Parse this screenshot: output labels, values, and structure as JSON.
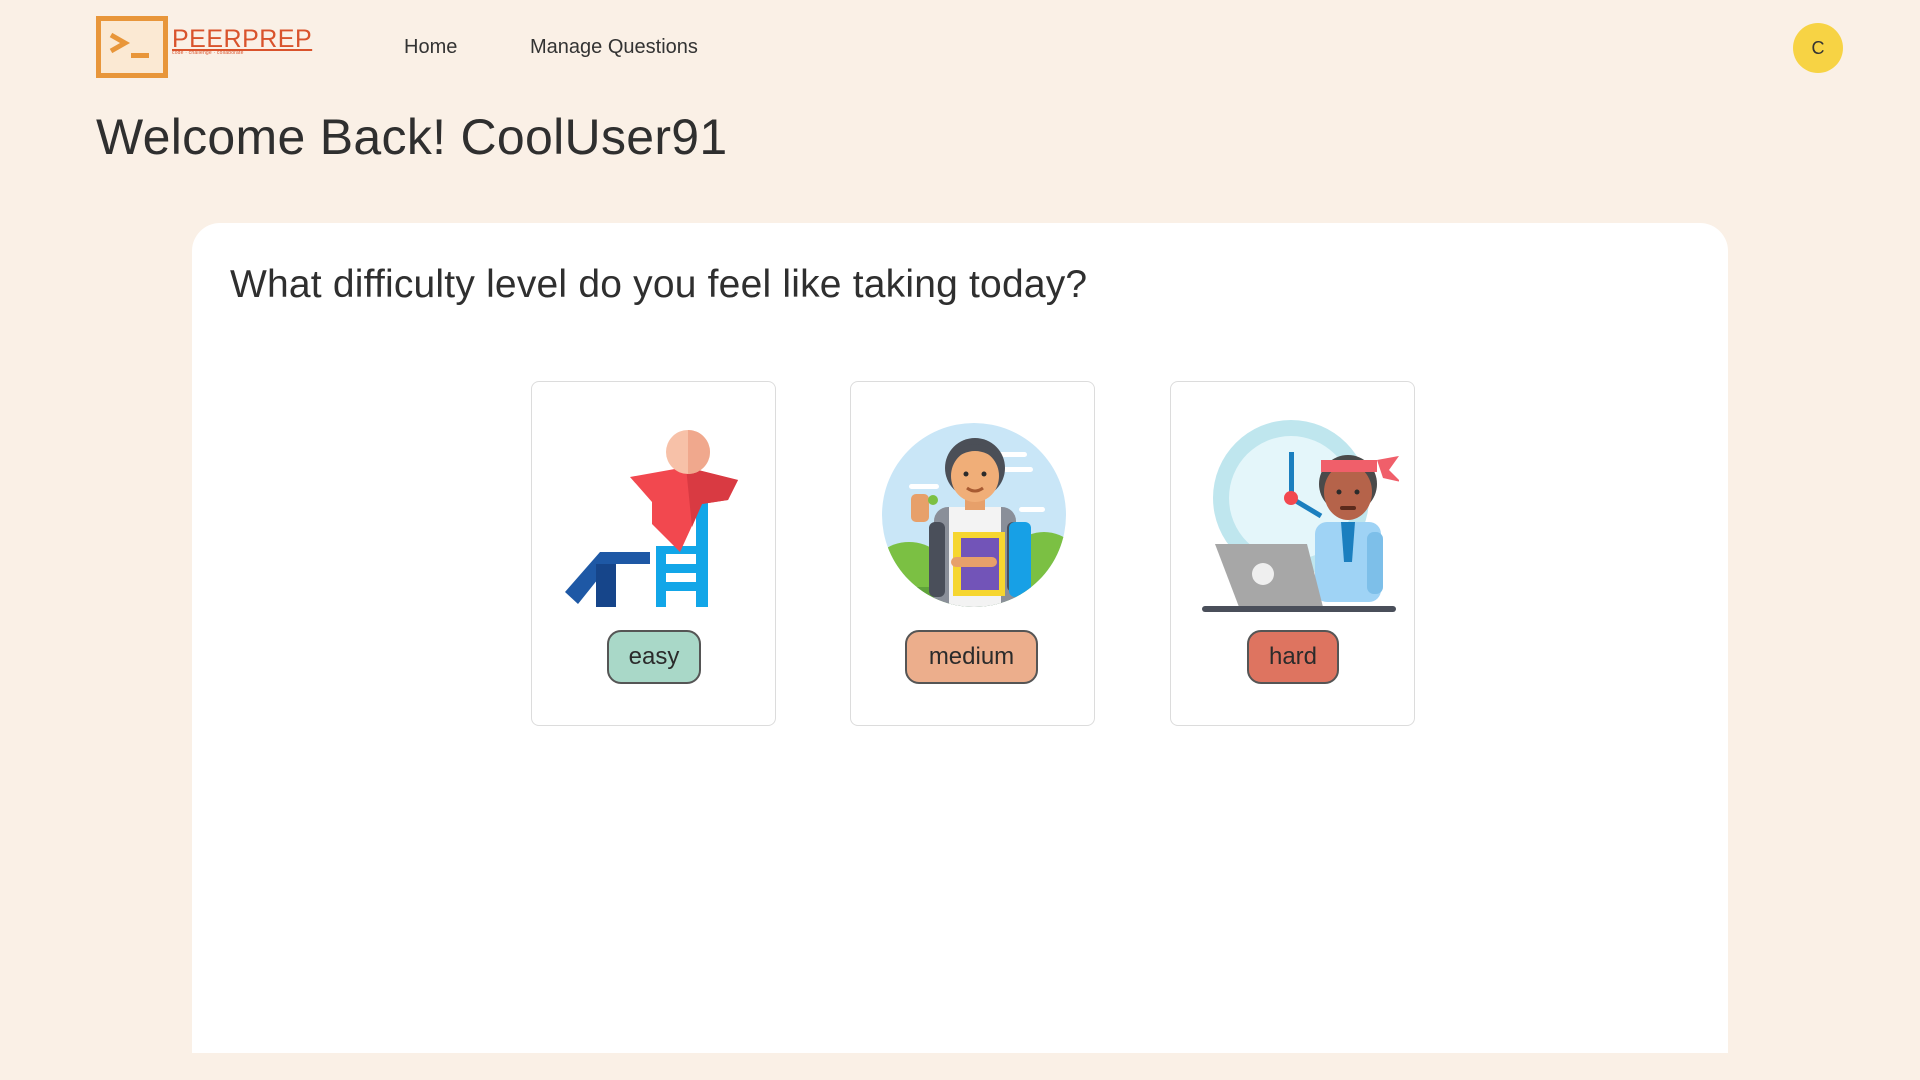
{
  "brand": {
    "title": "PEERPREP",
    "tagline": "code · challenge · collaborate",
    "accent": "#e8963a",
    "text_color": "#d9532c"
  },
  "nav": {
    "items": [
      {
        "label": "Home"
      },
      {
        "label": "Manage Questions"
      }
    ]
  },
  "user": {
    "avatar_initial": "C",
    "avatar_color": "#f7d344"
  },
  "welcome": "Welcome Back! CoolUser91",
  "prompt": "What difficulty level do you feel like taking today?",
  "difficulties": [
    {
      "label": "easy",
      "color": "#a9d8c8",
      "icon": "relaxed-person-chair-icon"
    },
    {
      "label": "medium",
      "color": "#ecae8c",
      "icon": "student-books-icon"
    },
    {
      "label": "hard",
      "color": "#de7460",
      "icon": "stressed-worker-clock-icon"
    }
  ]
}
